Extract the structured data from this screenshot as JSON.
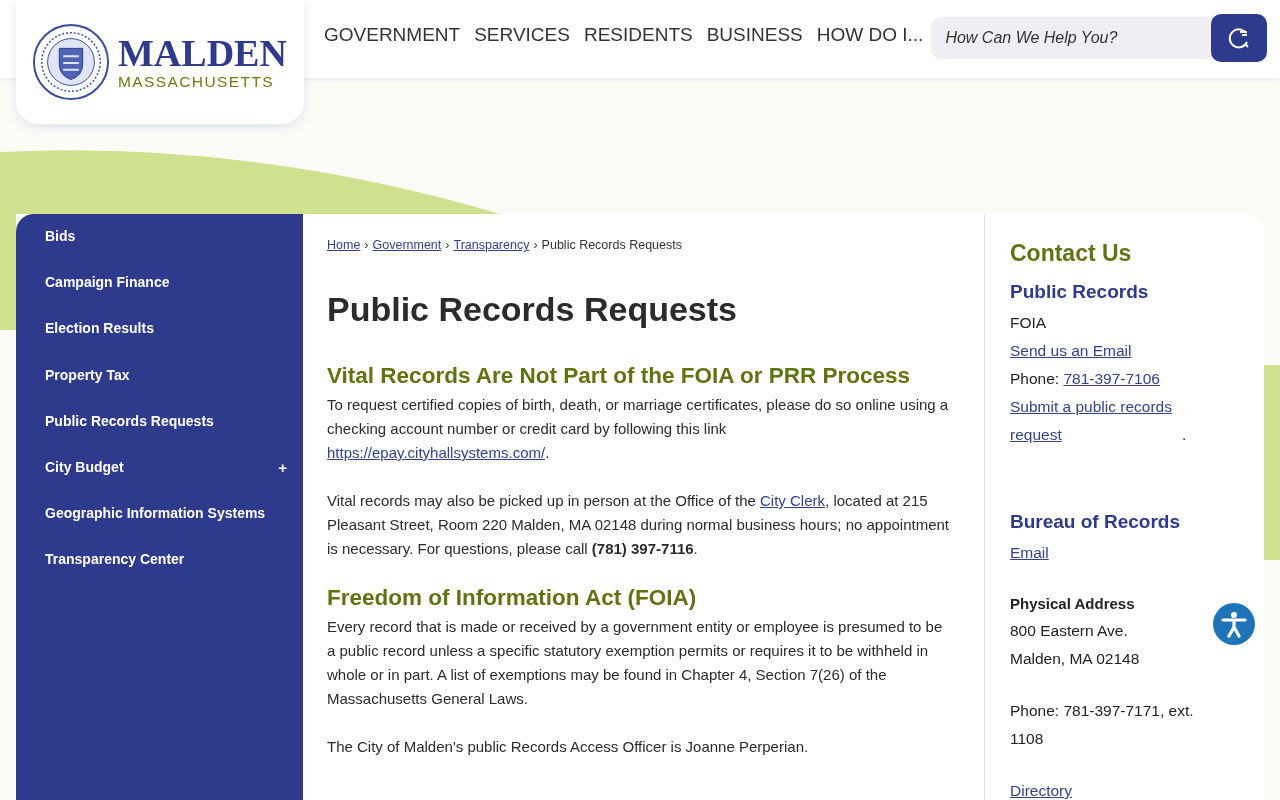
{
  "header": {
    "logo": {
      "name": "MALDEN",
      "state": "MASSACHUSETTS"
    },
    "nav": [
      "GOVERNMENT",
      "SERVICES",
      "RESIDENTS",
      "BUSINESS",
      "HOW DO I..."
    ],
    "search": {
      "placeholder": "How Can We Help You?"
    }
  },
  "sidebar": {
    "items": [
      {
        "label": "Bids"
      },
      {
        "label": "Campaign Finance"
      },
      {
        "label": "Election Results"
      },
      {
        "label": "Property Tax"
      },
      {
        "label": "Public Records Requests"
      },
      {
        "label": "City Budget",
        "expander": "+"
      },
      {
        "label": "Geographic Information Systems"
      },
      {
        "label": "Transparency Center"
      }
    ]
  },
  "breadcrumb": {
    "links": [
      "Home",
      "Government",
      "Transparency"
    ],
    "separator": "›",
    "current": "Public Records Requests"
  },
  "title": "Public Records Requests",
  "sections": [
    {
      "heading": "Vital Records Are Not Part of the FOIA  or PRR Process",
      "paragraphs": [
        [
          {
            "kind": "text",
            "text": "To request certified copies of birth, death, or marriage certificates, please do so online using a checking account number or credit card by following this link "
          },
          {
            "kind": "link",
            "text": "https://epay.cityhallsystems.com/"
          },
          {
            "kind": "text",
            "text": "."
          }
        ],
        [
          {
            "kind": "text",
            "text": "Vital records may also be picked up in person at the Office of the "
          },
          {
            "kind": "link",
            "text": "City Clerk"
          },
          {
            "kind": "text",
            "text": ", located at 215 Pleasant Street, Room 220 Malden, MA 02148 during normal business hours; no appointment is necessary. For questions, please call **(781) 397-7116**."
          }
        ]
      ]
    },
    {
      "heading": "Freedom of Information Act (FOIA)",
      "paragraphs": [
        [
          {
            "kind": "text",
            "text": "Every record that is made or received by a government entity or employee is presumed to be a public record unless a specific statutory exemption permits or requires it to be withheld in whole or in part. A list of exemptions may be found in Chapter 4, Section 7(26) of the Massachusetts General Laws."
          }
        ],
        [
          {
            "kind": "text",
            "text": "The City of Malden's public Records Access Officer is Joanne Perperian."
          }
        ]
      ]
    }
  ],
  "contact": {
    "title": "Contact Us",
    "groups": [
      {
        "heading": "Public Records",
        "lines": [
          [
            {
              "kind": "text",
              "text": "FOIA"
            }
          ],
          [
            {
              "kind": "link",
              "text": "Send us an Email"
            }
          ],
          [
            {
              "kind": "text",
              "text": "Phone: "
            },
            {
              "kind": "link",
              "text": "781-397-7106"
            }
          ],
          [
            {
              "kind": "link",
              "text": "Submit a public records request"
            },
            {
              "kind": "text",
              "text": "."
            }
          ]
        ]
      },
      {
        "heading": "Bureau of Records",
        "lines": [
          [
            {
              "kind": "link",
              "text": "Email"
            }
          ]
        ],
        "address_label": "Physical Address",
        "address": [
          "800 Eastern Ave.",
          "Malden, MA 02148"
        ],
        "phone": "Phone: 781-397-7171, ext. 1108",
        "directory": "Directory"
      }
    ]
  }
}
